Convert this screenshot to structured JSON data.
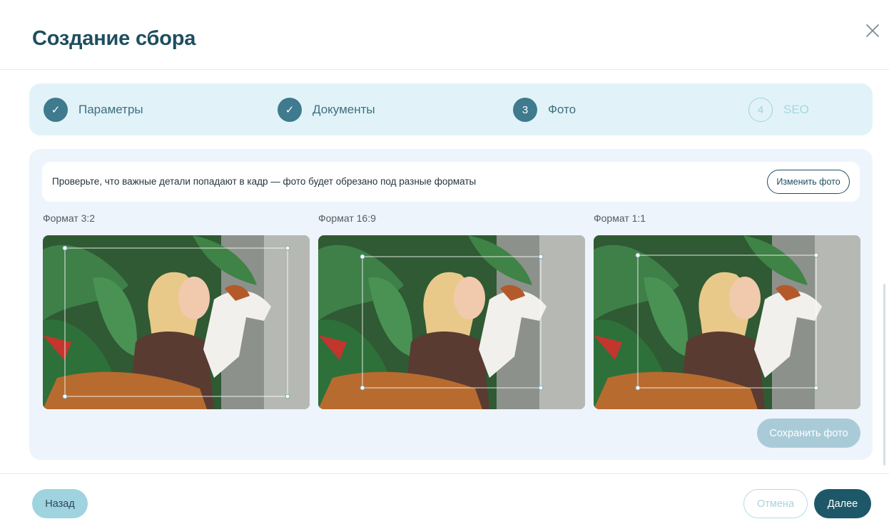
{
  "dialog": {
    "title": "Создание сбора",
    "close_icon": "close-icon"
  },
  "stepper": {
    "steps": [
      {
        "marker": "✓",
        "label": "Параметры",
        "state": "done"
      },
      {
        "marker": "✓",
        "label": "Документы",
        "state": "done"
      },
      {
        "marker": "3",
        "label": "Фото",
        "state": "active"
      },
      {
        "marker": "4",
        "label": "SEO",
        "state": "pending"
      }
    ]
  },
  "notice": {
    "text": "Проверьте, что важные детали попадают в кадр — фото будет обрезано под разные форматы",
    "change_button": "Изменить фото"
  },
  "formats": [
    {
      "label": "Формат 3:2"
    },
    {
      "label": "Формат 16:9"
    },
    {
      "label": "Формат 1:1"
    }
  ],
  "save_button": "Сохранить фото",
  "footer": {
    "back_button": "Назад",
    "cancel_button": "Отмена",
    "next_button": "Далее"
  },
  "colors": {
    "primary": "#1e5868",
    "title": "#1e4e5f",
    "stepper_bg": "#e1f3f8",
    "panel_bg": "#eef4fb",
    "disabled_button": "#a9cbd8",
    "light_accent": "#9fd3df"
  }
}
